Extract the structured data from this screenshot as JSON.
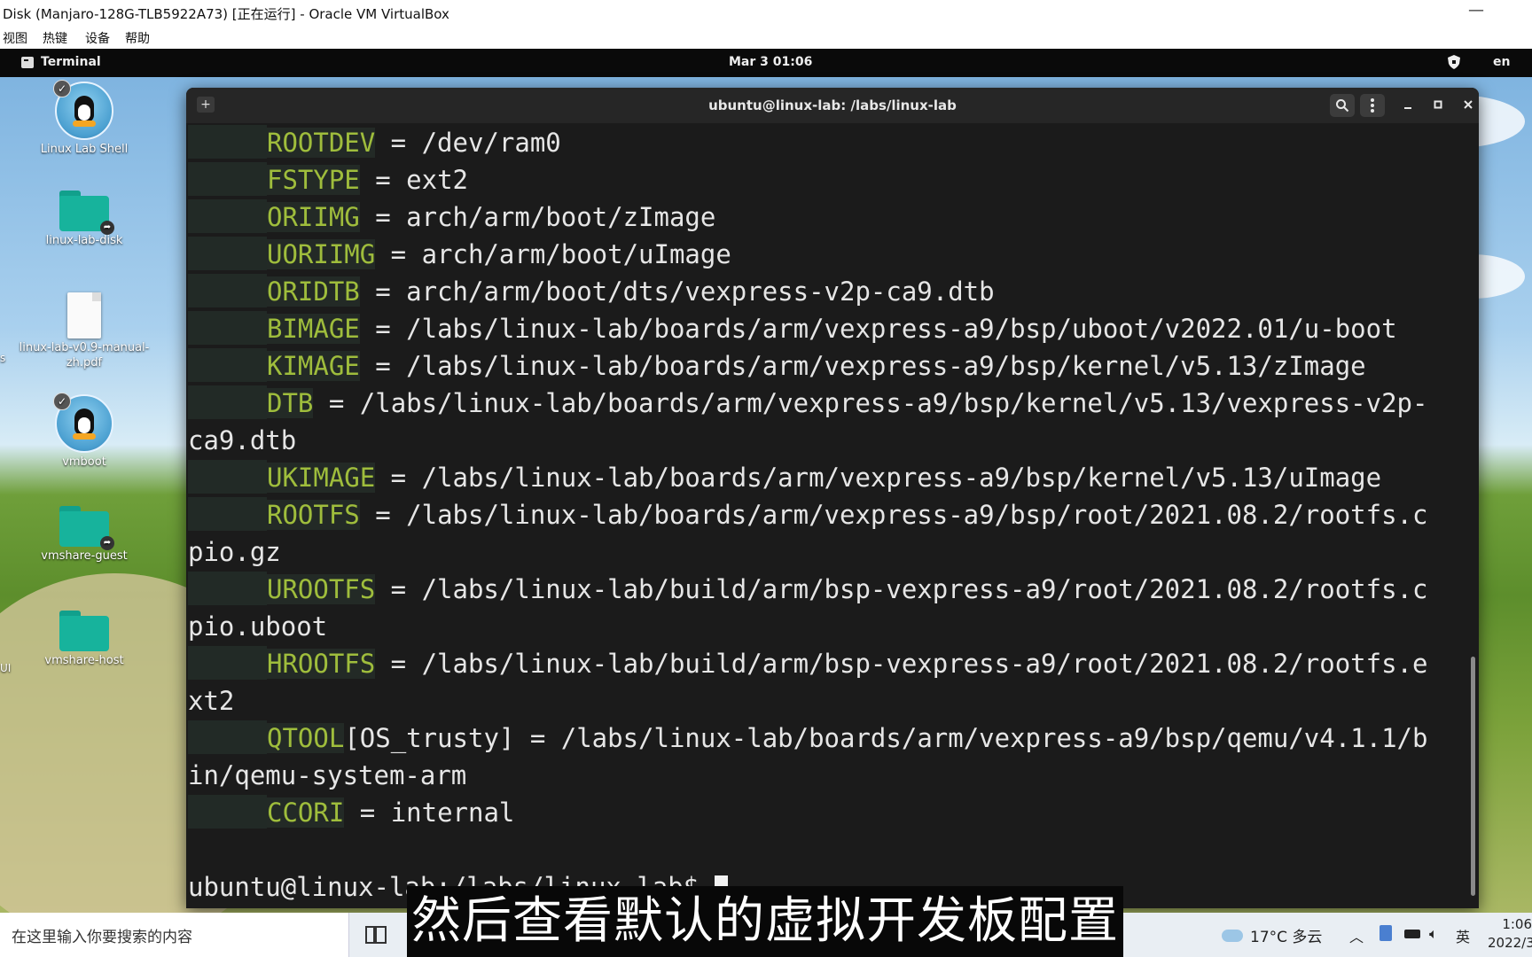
{
  "virtualbox": {
    "title": "Disk (Manjaro-128G-TLB5922A73) [正在运行] - Oracle VM VirtualBox",
    "minimize_glyph": "—",
    "menu": [
      "视图",
      "热键",
      "设备",
      "帮助"
    ]
  },
  "guest_topbar": {
    "app_name": "Terminal",
    "datetime": "Mar 3  01:06",
    "language": "en"
  },
  "desktop": {
    "icons": [
      {
        "label": "Linux Lab Shell",
        "icon": "penguin-app-icon"
      },
      {
        "label": "linux-lab-disk",
        "icon": "folder-icon"
      },
      {
        "label": "linux-lab-v0.9-manual-zh.pdf",
        "icon": "pdf-file-icon"
      },
      {
        "label": "vmboot",
        "icon": "penguin-app-icon"
      },
      {
        "label": "vmshare-guest",
        "icon": "folder-icon"
      },
      {
        "label": "vmshare-host",
        "icon": "folder-icon"
      }
    ],
    "edge_labels": [
      "s",
      "UI"
    ]
  },
  "terminal": {
    "title": "ubuntu@linux-lab: /labs/linux-lab",
    "lines": [
      {
        "key": "ROOTDEV",
        "rest": " = /dev/ram0"
      },
      {
        "key": "FSTYPE",
        "rest": " = ext2"
      },
      {
        "key": "ORIIMG",
        "rest": " = arch/arm/boot/zImage"
      },
      {
        "key": "UORIIMG",
        "rest": " = arch/arm/boot/uImage"
      },
      {
        "key": "ORIDTB",
        "rest": " = arch/arm/boot/dts/vexpress-v2p-ca9.dtb"
      },
      {
        "key": "BIMAGE",
        "rest": " = /labs/linux-lab/boards/arm/vexpress-a9/bsp/uboot/v2022.01/u-boot"
      },
      {
        "key": "KIMAGE",
        "rest": " = /labs/linux-lab/boards/arm/vexpress-a9/bsp/kernel/v5.13/zImage"
      },
      {
        "key": "DTB",
        "rest": " = /labs/linux-lab/boards/arm/vexpress-a9/bsp/kernel/v5.13/vexpress-v2p-"
      },
      {
        "cont": "ca9.dtb"
      },
      {
        "key": "UKIMAGE",
        "rest": " = /labs/linux-lab/boards/arm/vexpress-a9/bsp/kernel/v5.13/uImage"
      },
      {
        "key": "ROOTFS",
        "rest": " = /labs/linux-lab/boards/arm/vexpress-a9/bsp/root/2021.08.2/rootfs.c"
      },
      {
        "cont": "pio.gz"
      },
      {
        "key": "UROOTFS",
        "rest": " = /labs/linux-lab/build/arm/bsp-vexpress-a9/root/2021.08.2/rootfs.c"
      },
      {
        "cont": "pio.uboot"
      },
      {
        "key": "HROOTFS",
        "rest": " = /labs/linux-lab/build/arm/bsp-vexpress-a9/root/2021.08.2/rootfs.e"
      },
      {
        "cont": "xt2"
      },
      {
        "key": "QTOOL",
        "rest": "[OS_trusty] = /labs/linux-lab/boards/arm/vexpress-a9/bsp/qemu/v4.1.1/b"
      },
      {
        "cont": "in/qemu-system-arm"
      },
      {
        "key": "CCORI",
        "rest": " = internal"
      },
      {
        "cont": ""
      },
      {
        "prompt": "ubuntu@linux-lab:/labs/linux-lab$ "
      }
    ]
  },
  "taskbar": {
    "search_placeholder": "在这里输入你要搜索的内容",
    "weather": "17°C  多云",
    "ime": "英",
    "time": "1:06",
    "date": "2022/3"
  },
  "subtitle": "然后查看默认的虚拟开发板配置",
  "colors": {
    "terminal_bg": "#1b1b1b",
    "terminal_key": "#9fbd3c",
    "terminal_text": "#e6e6e6"
  }
}
